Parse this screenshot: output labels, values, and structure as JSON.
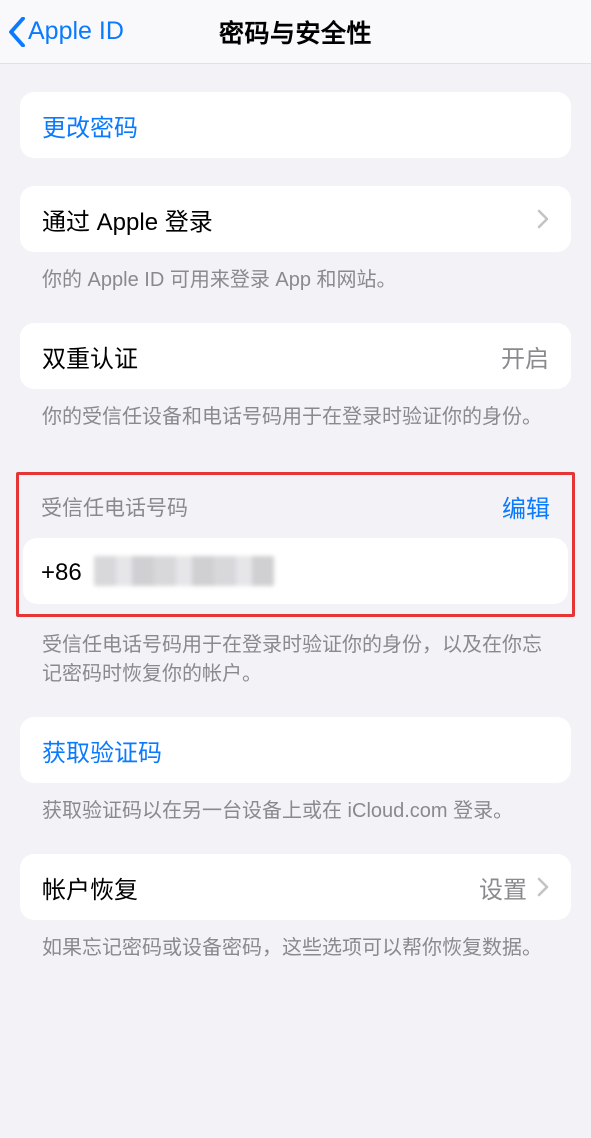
{
  "nav": {
    "back_label": "Apple ID",
    "title": "密码与安全性"
  },
  "change_password": {
    "label": "更改密码"
  },
  "sign_in_with_apple": {
    "label": "通过 Apple 登录",
    "footer": "你的 Apple ID 可用来登录 App 和网站。"
  },
  "two_factor": {
    "label": "双重认证",
    "value": "开启",
    "footer": "你的受信任设备和电话号码用于在登录时验证你的身份。"
  },
  "trusted_phone": {
    "header": "受信任电话号码",
    "edit": "编辑",
    "prefix": "+86",
    "footer": "受信任电话号码用于在登录时验证你的身份，以及在你忘记密码时恢复你的帐户。"
  },
  "get_code": {
    "label": "获取验证码",
    "footer": "获取验证码以在另一台设备上或在 iCloud.com 登录。"
  },
  "account_recovery": {
    "label": "帐户恢复",
    "value": "设置",
    "footer": "如果忘记密码或设备密码，这些选项可以帮你恢复数据。"
  }
}
